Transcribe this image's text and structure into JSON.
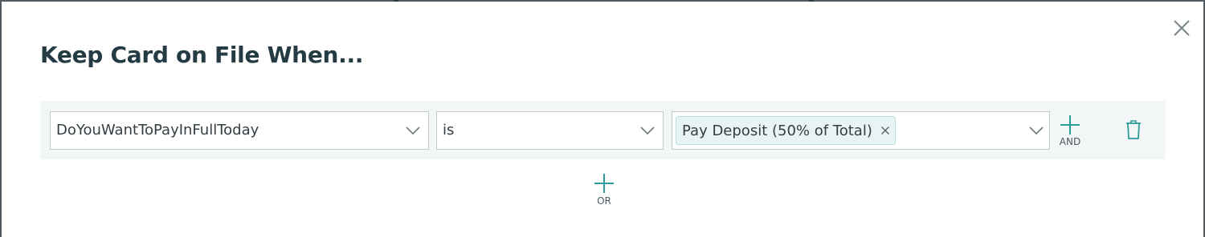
{
  "dialog": {
    "title": "Keep Card on File When..."
  },
  "rule": {
    "field_value": "DoYouWantToPayInFullToday",
    "operator_value": "is",
    "values": [
      {
        "label": "Pay Deposit (50% of Total)"
      }
    ],
    "and_label": "AND"
  },
  "or_label": "OR",
  "icons": {
    "close": "close-icon",
    "chevron": "chevron-down-icon",
    "tag_remove": "remove-tag-icon",
    "plus": "plus-icon",
    "trash": "trash-icon"
  },
  "colors": {
    "title": "#243b44",
    "accent": "#2a9d98",
    "row_background": "#f3f6f6",
    "tag_background": "#e8f4f4",
    "tag_border": "#b5e0df"
  }
}
